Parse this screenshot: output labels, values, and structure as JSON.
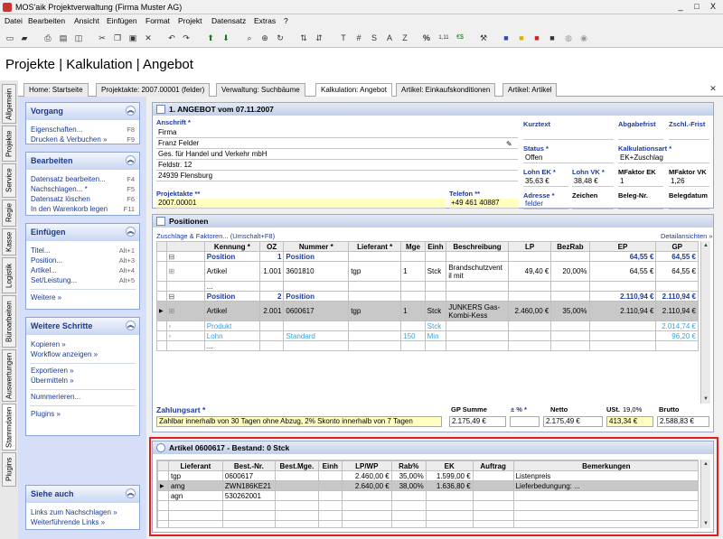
{
  "window": {
    "title": "MOS'aik Projektverwaltung (Firma Muster AG)",
    "controls": [
      "_",
      "□",
      "X"
    ]
  },
  "menu": [
    "Datei",
    "Bearbeiten",
    "Ansicht",
    "Einfügen",
    "Format",
    "Projekt",
    "Datensatz",
    "Extras",
    "?"
  ],
  "toolbar": {
    "glyphs": {
      "g1": "T",
      "g2": "#",
      "g3": "S",
      "g4": "A",
      "g5": "Z",
      "g6": "%",
      "g7": "1,11",
      "g8": "€$"
    }
  },
  "heading": "Projekte | Kalkulation | Angebot",
  "tabs": [
    "Home: Startseite",
    "Projektakte: 2007.00001 (felder)",
    "Verwaltung: Suchbäume",
    "Kalkulation: Angebot",
    "Artikel: Einkaufskonditionen",
    "Artikel: Artikel"
  ],
  "vtabs": [
    "Allgemein",
    "Projekte",
    "Service",
    "Regie",
    "Kasse",
    "Logistik",
    "Büroarbeiten",
    "Auswertungen",
    "Stammdaten",
    "Plugins"
  ],
  "nav": {
    "vorgang": {
      "title": "Vorgang",
      "items": [
        {
          "label": "Eigenschaften...",
          "key": "F8"
        },
        {
          "label": "Drucken & Verbuchen »",
          "key": "F9"
        }
      ]
    },
    "bearbeiten": {
      "title": "Bearbeiten",
      "items": [
        {
          "label": "Datensatz bearbeiten...",
          "key": "F4"
        },
        {
          "label": "Nachschlagen... *",
          "key": "F5"
        },
        {
          "label": "Datensatz löschen",
          "key": "F6"
        },
        {
          "label": "In den Warenkorb legen",
          "key": "F11"
        }
      ]
    },
    "einfuegen": {
      "title": "Einfügen",
      "items": [
        {
          "label": "Titel...",
          "key": "Alt+1"
        },
        {
          "label": "Position...",
          "key": "Alt+3"
        },
        {
          "label": "Artikel...",
          "key": "Alt+4"
        },
        {
          "label": "Set/Leistung...",
          "key": "Alt+5"
        }
      ],
      "more": "Weitere »"
    },
    "schritte": {
      "title": "Weitere Schritte",
      "items": [
        "Kopieren »",
        "Workflow anzeigen »",
        "Exportieren »",
        "Übermitteln »",
        "Nummerieren...",
        "Plugins »"
      ]
    },
    "siehe": {
      "title": "Siehe auch",
      "items": [
        "Links zum Nachschlagen »",
        "Weiterführende Links »"
      ]
    }
  },
  "angebot": {
    "title": "1. ANGEBOT vom 07.11.2007",
    "anschrift_label": "Anschrift *",
    "anschrift": [
      "Firma",
      "Franz Felder",
      "Ges. für Handel und Verkehr mbH",
      "Feldstr. 12",
      "24939   Flensburg"
    ],
    "kurztext_label": "Kurztext",
    "abgabefrist_label": "Abgabefrist",
    "zschl_label": "Zschl.-Frist",
    "status_label": "Status *",
    "status": "Offen",
    "kalkart_label": "Kalkulationsart *",
    "kalkart": "EK+Zuschlag",
    "lohn_ek_label": "Lohn EK *",
    "lohn_ek": "35,63 €",
    "lohn_vk_label": "Lohn VK *",
    "lohn_vk": "38,48 €",
    "mfaktor_ek_label": "MFaktor EK",
    "mfaktor_ek": "1",
    "mfaktor_vk_label": "MFaktor VK",
    "mfaktor_vk": "1,26",
    "projektakte_label": "Projektakte **",
    "projektakte": "2007.00001",
    "telefon_label": "Telefon **",
    "telefon": "+49 461 40887",
    "adresse_label": "Adresse *",
    "adresse": "felder",
    "zeichen_label": "Zeichen",
    "belegnr_label": "Beleg-Nr.",
    "belegdatum_label": "Belegdatum"
  },
  "positionen": {
    "title": "Positionen",
    "link_left": "Zuschläge & Faktoren... (Umschalt+F8)",
    "link_right": "Detailansichten »",
    "columns": [
      "Kennung *",
      "OZ",
      "Nummer *",
      "Lieferant *",
      "Mge",
      "Einh",
      "Beschreibung",
      "LP",
      "BezRab",
      "EP",
      "GP"
    ],
    "rows": [
      {
        "cls": "posrow",
        "cells": [
          "Position",
          "1",
          "Position",
          "",
          "",
          "",
          "",
          "",
          "",
          "64,55 €",
          "64,55 €"
        ]
      },
      {
        "cls": "",
        "cells": [
          "Artikel",
          "1.001",
          "3601810",
          "tgp",
          "1",
          "Stck",
          "Brandschutzvent il mit",
          "49,40 €",
          "20,00%",
          "64,55 €",
          "64,55 €"
        ]
      },
      {
        "cls": "",
        "cells": [
          "...",
          "",
          "",
          "",
          "",
          "",
          "",
          "",
          "",
          "",
          ""
        ]
      },
      {
        "cls": "posrow",
        "cells": [
          "Position",
          "2",
          "Position",
          "",
          "",
          "",
          "",
          "",
          "",
          "2.110,94 €",
          "2.110,94 €"
        ]
      },
      {
        "cls": "sel",
        "cells": [
          "Artikel",
          "2.001",
          "0600617",
          "tgp",
          "1",
          "Stck",
          "JUNKERS Gas-Kombi-Kess",
          "2.460,00 €",
          "35,00%",
          "2.110,94 €",
          "2.110,94 €"
        ]
      },
      {
        "cls": "subrow",
        "cells": [
          "Produkt",
          "",
          "",
          "",
          "",
          "Stck",
          "",
          "",
          "",
          "",
          "2.014,74 €"
        ]
      },
      {
        "cls": "subrow",
        "cells": [
          "Lohn",
          "",
          "Standard",
          "",
          "150",
          "Min",
          "",
          "",
          "",
          "",
          "96,20 €"
        ]
      },
      {
        "cls": "",
        "cells": [
          "...",
          "",
          "",
          "",
          "",
          "",
          "",
          "",
          "",
          "",
          ""
        ]
      }
    ],
    "zahlung_label": "Zahlungsart *",
    "zahlung": "Zahlbar innerhalb von 30 Tagen ohne Abzug, 2% Skonto innerhalb von 7 Tagen",
    "gp_summe_label": "GP Summe",
    "gp_summe": "2.175,49 €",
    "pct_label": "± % *",
    "pct": "",
    "netto_label": "Netto",
    "netto": "2.175,49 €",
    "ust_label": "USt.",
    "ust_rate": "19,0%",
    "ust": "413,34 €",
    "brutto_label": "Brutto",
    "brutto": "2.588,83 €"
  },
  "artikel": {
    "title": "Artikel 0600617 - Bestand: 0 Stck",
    "columns": [
      "Lieferant",
      "Best.-Nr.",
      "Best.Mge.",
      "Einh",
      "LP/WP",
      "Rab%",
      "EK",
      "Auftrag",
      "Bemerkungen"
    ],
    "rows": [
      {
        "cls": "",
        "cells": [
          "tgp",
          "0600617",
          "",
          "",
          "2.460,00 €",
          "35,00%",
          "1.599,00 €",
          "",
          "Listenpreis"
        ]
      },
      {
        "cls": "sel",
        "cells": [
          "amg",
          "ZWN186KE21",
          "",
          "",
          "2.640,00 €",
          "38,00%",
          "1.636,80 €",
          "",
          "Lieferbedungung: ..."
        ]
      },
      {
        "cls": "",
        "cells": [
          "agn",
          "530262001",
          "",
          "",
          "",
          "",
          "",
          "",
          ""
        ]
      }
    ]
  }
}
